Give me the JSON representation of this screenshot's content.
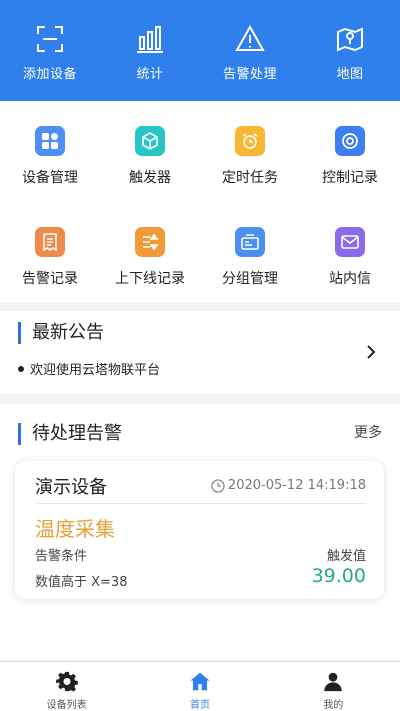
{
  "top_menu": [
    {
      "label": "添加设备",
      "icon": "scan-icon"
    },
    {
      "label": "统计",
      "icon": "bar-chart-icon"
    },
    {
      "label": "告警处理",
      "icon": "warning-icon"
    },
    {
      "label": "地图",
      "icon": "map-icon"
    }
  ],
  "grid_items": [
    {
      "label": "设备管理",
      "icon": "device-manage-icon",
      "color": "#4f8ef7"
    },
    {
      "label": "触发器",
      "icon": "cube-icon",
      "color": "#26c6c6"
    },
    {
      "label": "定时任务",
      "icon": "alarm-clock-icon",
      "color": "#f7b733"
    },
    {
      "label": "控制记录",
      "icon": "target-icon",
      "color": "#3d7ff0"
    },
    {
      "label": "告警记录",
      "icon": "receipt-icon",
      "color": "#f08a4b"
    },
    {
      "label": "上下线记录",
      "icon": "up-down-icon",
      "color": "#f29a3a"
    },
    {
      "label": "分组管理",
      "icon": "group-card-icon",
      "color": "#4a90f0"
    },
    {
      "label": "站内信",
      "icon": "mail-icon",
      "color": "#8a6ae8"
    }
  ],
  "notice": {
    "title": "最新公告",
    "item": "欢迎使用云塔物联平台"
  },
  "alarms": {
    "title": "待处理告警",
    "more": "更多",
    "card": {
      "device": "演示设备",
      "time": "2020-05-12 14:19:18",
      "type": "温度采集",
      "condition_label": "告警条件",
      "trigger_label": "触发值",
      "condition": "数值高于 X=38",
      "value": "39.00"
    }
  },
  "tabbar": [
    {
      "label": "设备列表",
      "icon": "gear-icon"
    },
    {
      "label": "首页",
      "icon": "home-icon"
    },
    {
      "label": "我的",
      "icon": "user-icon"
    }
  ],
  "colors": {
    "primary": "#2f80ed",
    "warning": "#e6a23c",
    "value": "#27a889"
  }
}
